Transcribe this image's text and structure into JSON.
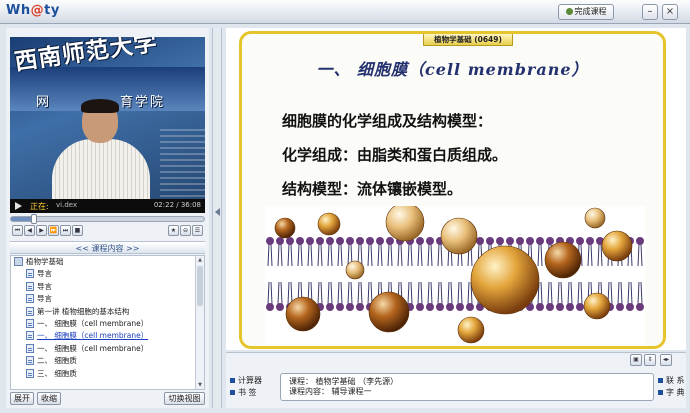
{
  "app": {
    "logo_prefix": "Wh",
    "logo_at": "@",
    "logo_suffix": "ty"
  },
  "titlebar": {
    "finish_label": "完成课程",
    "min_glyph": "–",
    "close_glyph": "×"
  },
  "video": {
    "school_name": "西南师范大学",
    "sub_left": "网",
    "sub_right": "育学院",
    "status_label": "正在:",
    "file_name": "vi.dex",
    "time": "02:22 / 36:08",
    "progress": 0.12
  },
  "player_controls": [
    "⏮",
    "◀",
    "▶",
    "⏩",
    "⏭",
    "■"
  ],
  "player_extra": [
    "★",
    "⊖",
    "☰"
  ],
  "toc": {
    "header": "<< 课程内容 >>",
    "root": "植物学基础",
    "items": [
      {
        "label": "导言",
        "active": false,
        "indent": 1
      },
      {
        "label": "导言",
        "active": false,
        "indent": 1
      },
      {
        "label": "导言",
        "active": false,
        "indent": 1
      },
      {
        "label": "第一讲 植物细胞的基本结构",
        "active": false,
        "indent": 1
      },
      {
        "label": "一、 细胞膜（cell membrane）",
        "active": false,
        "indent": 1
      },
      {
        "label": "一、 细胞膜（cell membrane）",
        "active": true,
        "indent": 1
      },
      {
        "label": "一、 细胞膜（cell membrane）",
        "active": false,
        "indent": 1
      },
      {
        "label": "二、 细胞质",
        "active": false,
        "indent": 1
      },
      {
        "label": "三、 细胞质",
        "active": false,
        "indent": 1
      }
    ]
  },
  "left_buttons": {
    "expand": "展开",
    "collapse": "收缩",
    "switch_view": "切换视图"
  },
  "slide": {
    "course_tab": "植物学基础 (0649)",
    "title": "一、 细胞膜（cell membrane）",
    "lines": [
      "细胞膜的化学组成及结构模型：",
      "化学组成：由脂类和蛋白质组成。",
      "结构模型：流体镶嵌模型。"
    ]
  },
  "bottom": {
    "left_items": [
      "计算器",
      "书 签"
    ],
    "course_line": "课程：  植物学基础 （李先源）",
    "content_line": "课程内容：  辅导课程一",
    "right_items": [
      "联 系",
      "字 典"
    ]
  },
  "colors": {
    "accent": "#1e4f9c",
    "slide_border": "#e6c52c",
    "title": "#24316f"
  }
}
